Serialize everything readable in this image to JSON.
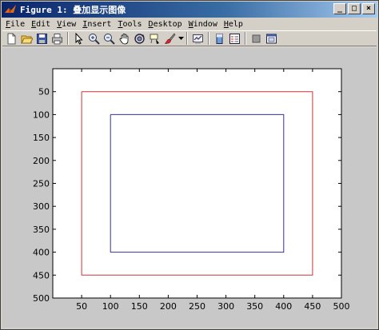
{
  "window": {
    "title": "Figure 1: 叠加显示图像"
  },
  "title_buttons": {
    "minimize": "_",
    "maximize": "□",
    "close": "×"
  },
  "menu": [
    {
      "label": "File",
      "accel": "F"
    },
    {
      "label": "Edit",
      "accel": "E"
    },
    {
      "label": "View",
      "accel": "V"
    },
    {
      "label": "Insert",
      "accel": "I"
    },
    {
      "label": "Tools",
      "accel": "T"
    },
    {
      "label": "Desktop",
      "accel": "D"
    },
    {
      "label": "Window",
      "accel": "W"
    },
    {
      "label": "Help",
      "accel": "H"
    }
  ],
  "toolbar_icons": [
    "new-figure-icon",
    "open-file-icon",
    "save-icon",
    "print-icon",
    "select-arrow-icon",
    "zoom-in-icon",
    "zoom-out-icon",
    "pan-hand-icon",
    "rotate-3d-icon",
    "data-cursor-icon",
    "brush-icon",
    "link-plot-icon",
    "colorbar-icon",
    "legend-icon",
    "hide-plot-tools-icon",
    "show-plot-tools-icon"
  ],
  "colors": {
    "outer_rect": "#cc3333",
    "inner_rect": "#333399",
    "axes_bg": "#ffffff",
    "figure_bg": "#c8c8c8"
  },
  "chart_data": {
    "type": "line",
    "xlim": [
      0,
      500
    ],
    "ylim": [
      0,
      500
    ],
    "xticks": [
      50,
      100,
      150,
      200,
      250,
      300,
      350,
      400,
      450,
      500
    ],
    "yticks": [
      50,
      100,
      150,
      200,
      250,
      300,
      350,
      400,
      450,
      500
    ],
    "y_direction": "reverse",
    "grid": false,
    "series": [
      {
        "color": "#cc3333",
        "x": [
          50,
          450,
          450,
          50,
          50
        ],
        "y": [
          50,
          50,
          450,
          450,
          50
        ]
      },
      {
        "color": "#333399",
        "x": [
          100,
          400,
          400,
          100,
          100
        ],
        "y": [
          100,
          100,
          400,
          400,
          100
        ]
      }
    ]
  }
}
